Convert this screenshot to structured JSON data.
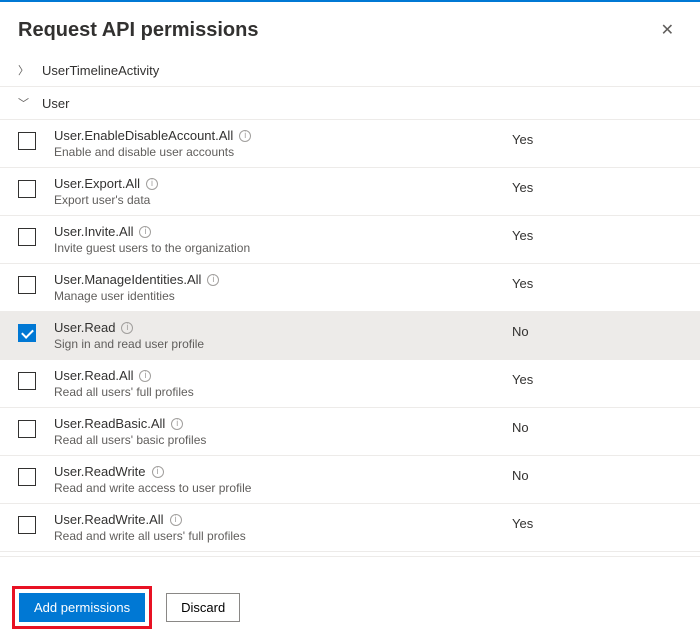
{
  "title": "Request API permissions",
  "groups": {
    "collapsed": {
      "label": "UserTimelineActivity"
    },
    "expanded": {
      "label": "User"
    }
  },
  "permissions": [
    {
      "name": "User.EnableDisableAccount.All",
      "desc": "Enable and disable user accounts",
      "admin": "Yes",
      "checked": false
    },
    {
      "name": "User.Export.All",
      "desc": "Export user's data",
      "admin": "Yes",
      "checked": false
    },
    {
      "name": "User.Invite.All",
      "desc": "Invite guest users to the organization",
      "admin": "Yes",
      "checked": false
    },
    {
      "name": "User.ManageIdentities.All",
      "desc": "Manage user identities",
      "admin": "Yes",
      "checked": false
    },
    {
      "name": "User.Read",
      "desc": "Sign in and read user profile",
      "admin": "No",
      "checked": true
    },
    {
      "name": "User.Read.All",
      "desc": "Read all users' full profiles",
      "admin": "Yes",
      "checked": false
    },
    {
      "name": "User.ReadBasic.All",
      "desc": "Read all users' basic profiles",
      "admin": "No",
      "checked": false
    },
    {
      "name": "User.ReadWrite",
      "desc": "Read and write access to user profile",
      "admin": "No",
      "checked": false
    },
    {
      "name": "User.ReadWrite.All",
      "desc": "Read and write all users' full profiles",
      "admin": "Yes",
      "checked": false
    }
  ],
  "buttons": {
    "add": "Add permissions",
    "discard": "Discard"
  }
}
